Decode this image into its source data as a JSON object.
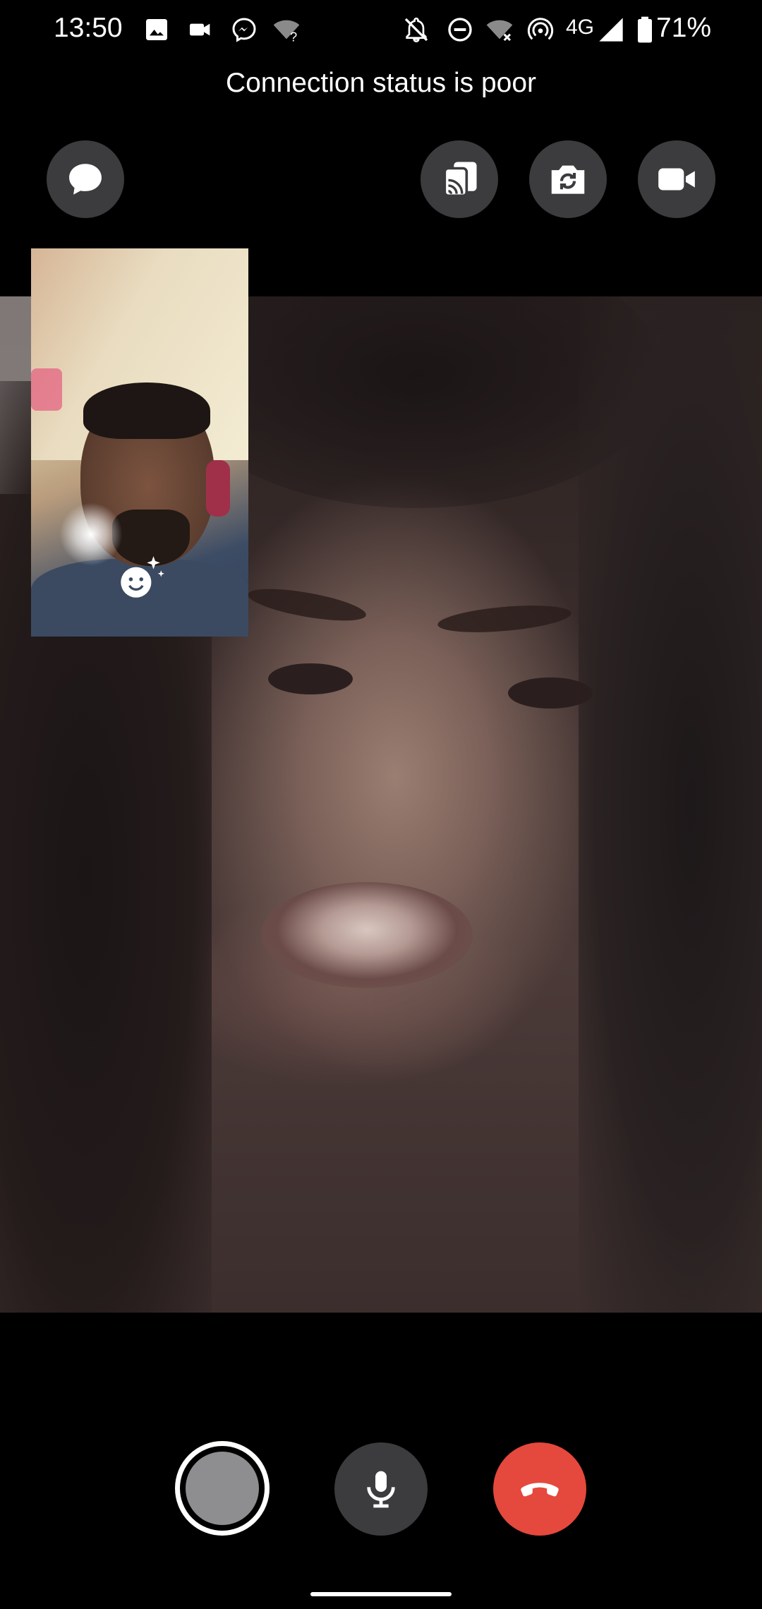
{
  "status_bar": {
    "time": "13:50",
    "network": "4G",
    "battery": "71%",
    "icons": [
      "image-icon",
      "video-camera-icon",
      "messenger-icon",
      "wifi-unknown-icon",
      "notifications-off-icon",
      "do-not-disturb-icon",
      "wifi-off-icon",
      "hotspot-icon",
      "signal-icon",
      "battery-icon"
    ]
  },
  "call": {
    "connection_status": "Connection status is poor"
  },
  "top_controls": {
    "chat": "chat-icon",
    "cast": "cast-icon",
    "switch_camera": "switch-camera-icon",
    "video": "video-camera-icon"
  },
  "self_preview": {
    "effects": "effects-icon"
  },
  "bottom_controls": {
    "capture": "capture-icon",
    "mic": "microphone-icon",
    "end_call": "end-call-icon"
  },
  "colors": {
    "background": "#000000",
    "button_bg": "#3c3c3e",
    "end_call": "#e5483d",
    "text": "#ffffff"
  }
}
